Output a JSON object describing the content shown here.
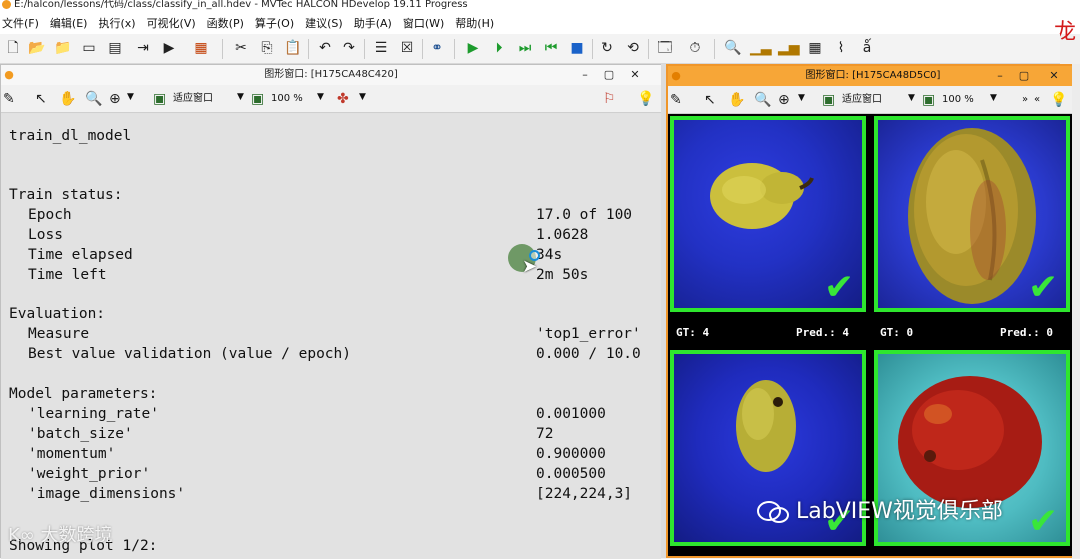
{
  "app": {
    "title": "E:/halcon/lessons/代码/class/classify_in_all.hdev - MVTec HALCON HDevelop 19.11 Progress",
    "brand_char": "龙"
  },
  "menu": [
    "文件(F)",
    "编辑(E)",
    "执行(x)",
    "可视化(V)",
    "函数(P)",
    "算子(O)",
    "建议(S)",
    "助手(A)",
    "窗口(W)",
    "帮助(H)"
  ],
  "left_window": {
    "title": "图形窗口: [H175CA48C420]",
    "fit_label": "适应窗口",
    "zoom_label": "100 %"
  },
  "right_window": {
    "title": "图形窗口: [H175CA48D5C0]",
    "fit_label": "适应窗口",
    "zoom_label": "100 %"
  },
  "console": {
    "heading": "train_dl_model",
    "train_status_label": "Train status:",
    "train_status": [
      {
        "label": "Epoch",
        "value": "17.0 of 100"
      },
      {
        "label": "Loss",
        "value": "1.0628"
      },
      {
        "label": "Time elapsed",
        "value": "34s"
      },
      {
        "label": "Time left",
        "value": "2m 50s"
      }
    ],
    "evaluation_label": "Evaluation:",
    "evaluation": [
      {
        "label": "Measure",
        "value": "'top1_error'"
      },
      {
        "label": "Best value validation (value / epoch)",
        "value": "0.000 / 10.0"
      }
    ],
    "model_params_label": "Model parameters:",
    "model_params": [
      {
        "label": "'learning_rate'",
        "value": "0.001000"
      },
      {
        "label": "'batch_size'",
        "value": "72"
      },
      {
        "label": "'momentum'",
        "value": "0.900000"
      },
      {
        "label": "'weight_prior'",
        "value": "0.000500"
      },
      {
        "label": "'image_dimensions'",
        "value": "[224,224,3]"
      }
    ],
    "footer": "Showing plot 1/2:"
  },
  "samples": {
    "row1": [
      {
        "gt": "GT: 4",
        "pred": "Pred.: 4"
      },
      {
        "gt": "GT: 0",
        "pred": "Pred.: 0"
      }
    ]
  },
  "overlay": {
    "watermark": "LabVIEW视觉俱乐部",
    "logo": "大数跨境"
  },
  "colors": {
    "correct_frame": "#2ee62e",
    "right_window_accent": "#f5a630"
  }
}
